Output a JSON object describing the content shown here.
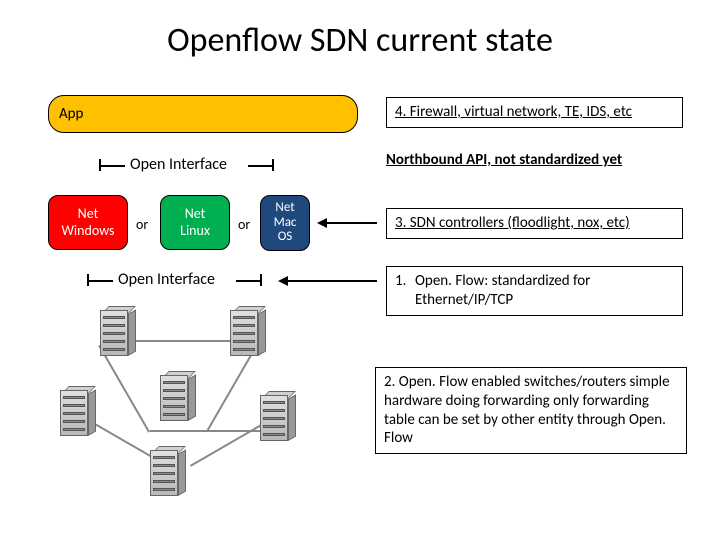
{
  "title": "Openflow SDN current state",
  "app_label": "App",
  "open_interface_label": "Open Interface",
  "controllers": {
    "windows": "Net\nWindows",
    "linux": "Net\nLinux",
    "mac": "Net\nMac\nOS",
    "or": "or"
  },
  "notes": {
    "n1": "4. Firewall, virtual network, TE, IDS, etc",
    "n2": "Northbound API, not standardized yet",
    "n3": "3. SDN controllers (floodlight, nox, etc)",
    "n4_num": "1.",
    "n4": "Open. Flow: standardized for Ethernet/IP/TCP",
    "n5": "2. Open. Flow enabled switches/routers simple hardware doing forwarding only forwarding table can be set by other entity through Open. Flow"
  }
}
